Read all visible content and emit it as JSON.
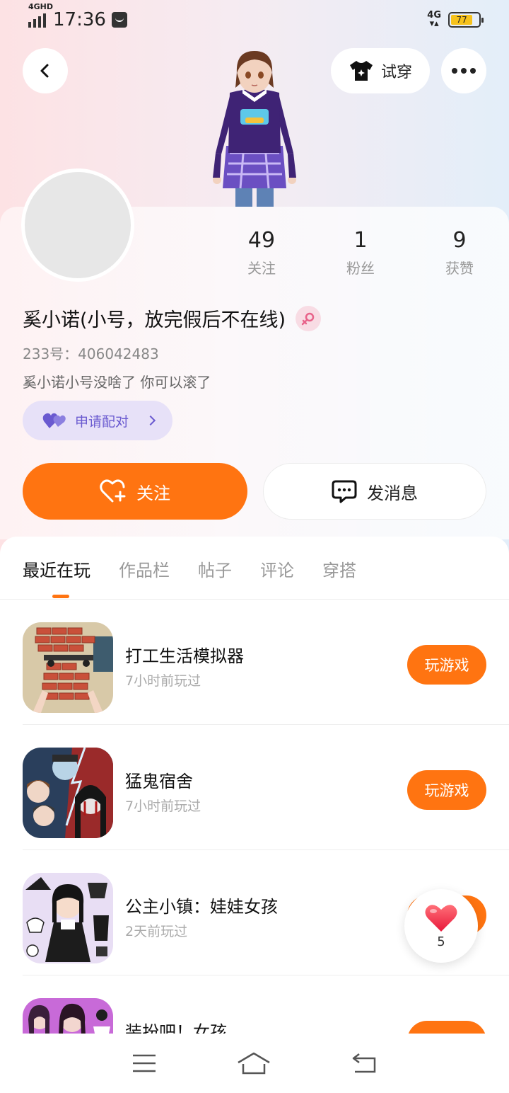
{
  "status_bar": {
    "network": "4GHD",
    "time": "17:36",
    "right_network": "4G",
    "battery": "77"
  },
  "header": {
    "tryon_label": "试穿"
  },
  "profile": {
    "stats": [
      {
        "num": "49",
        "label": "关注"
      },
      {
        "num": "1",
        "label": "粉丝"
      },
      {
        "num": "9",
        "label": "获赞"
      }
    ],
    "nickname": "奚小诺(小号，放完假后不在线)",
    "uid": "233号：406042483",
    "bio": "奚小诺小号没啥了 你可以滚了",
    "pair_label": "申请配对",
    "follow_label": "关注",
    "message_label": "发消息"
  },
  "tabs": [
    "最近在玩",
    "作品栏",
    "帖子",
    "评论",
    "穿搭"
  ],
  "games": [
    {
      "name": "打工生活模拟器",
      "time": "7小时前玩过",
      "button": "玩游戏"
    },
    {
      "name": "猛鬼宿舍",
      "time": "7小时前玩过",
      "button": "玩游戏"
    },
    {
      "name": "公主小镇：娃娃女孩",
      "time": "2天前玩过",
      "button": "玩游戏"
    },
    {
      "name": "装扮吧！女孩",
      "time": "",
      "button": ""
    }
  ],
  "like_float": {
    "count": "5"
  },
  "colors": {
    "accent": "#ff7411",
    "pair": "#6a5ad0"
  }
}
